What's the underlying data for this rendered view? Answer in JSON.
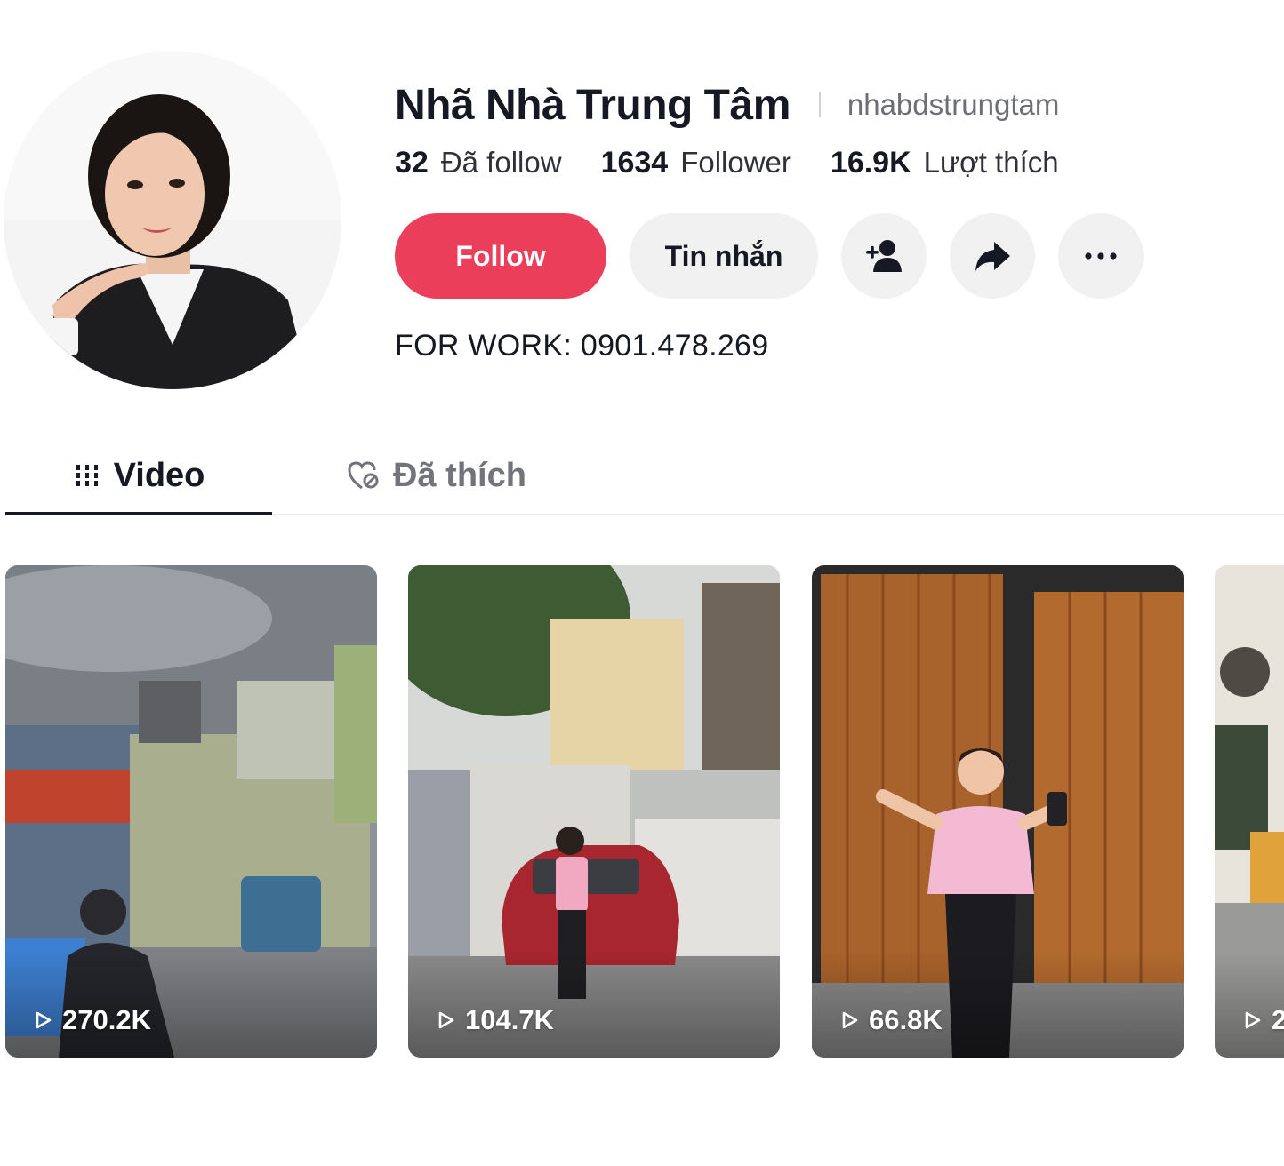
{
  "profile": {
    "display_name": "Nhã Nhà Trung Tâm",
    "username": "nhabdstrungtam",
    "avatar_icon": "avatar-photo",
    "stats": {
      "following_count": "32",
      "following_label": "Đã follow",
      "followers_count": "1634",
      "followers_label": "Follower",
      "likes_count": "16.9K",
      "likes_label": "Lượt thích"
    },
    "bio": "FOR WORK: 0901.478.269"
  },
  "actions": {
    "follow_label": "Follow",
    "message_label": "Tin nhắn",
    "add_friend_icon": "add-user-icon",
    "share_icon": "share-icon",
    "more_icon": "more-icon"
  },
  "tabs": [
    {
      "label": "Video",
      "icon": "grid-icon",
      "active": true
    },
    {
      "label": "Đã thích",
      "icon": "liked-heart-icon",
      "active": false
    }
  ],
  "videos": [
    {
      "views": "270.2K"
    },
    {
      "views": "104.7K"
    },
    {
      "views": "66.8K"
    },
    {
      "views": "2"
    }
  ],
  "colors": {
    "follow_button": "#ea3e5b",
    "secondary_button": "#f1f1f2",
    "text_primary": "#161823",
    "text_secondary": "#6e6f76"
  }
}
